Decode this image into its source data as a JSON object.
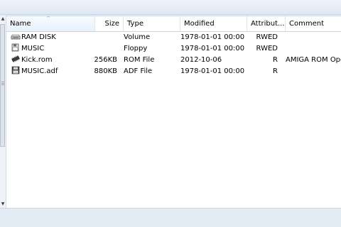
{
  "listview": {
    "columns": {
      "name": "Name",
      "size": "Size",
      "type": "Type",
      "modified": "Modified",
      "attributes": "Attribut...",
      "comment": "Comment"
    },
    "sort_column": "name",
    "rows": [
      {
        "icon": "ram-disk-icon",
        "name": "RAM DISK",
        "size": "",
        "type": "Volume",
        "modified": "1978-01-01 00:00",
        "attributes": "RWED",
        "comment": ""
      },
      {
        "icon": "floppy-drive-icon",
        "name": "MUSIC",
        "size": "",
        "type": "Floppy",
        "modified": "1978-01-01 00:00",
        "attributes": "RWED",
        "comment": ""
      },
      {
        "icon": "rom-chip-icon",
        "name": "Kick.rom",
        "size": "256KB",
        "type": "ROM File",
        "modified": "2012-10-06",
        "attributes": "R",
        "comment": "AMIGA ROM Ope"
      },
      {
        "icon": "disk-image-icon",
        "name": "MUSIC.adf",
        "size": "880KB",
        "type": "ADF File",
        "modified": "1978-01-01 00:00",
        "attributes": "R",
        "comment": ""
      }
    ]
  }
}
